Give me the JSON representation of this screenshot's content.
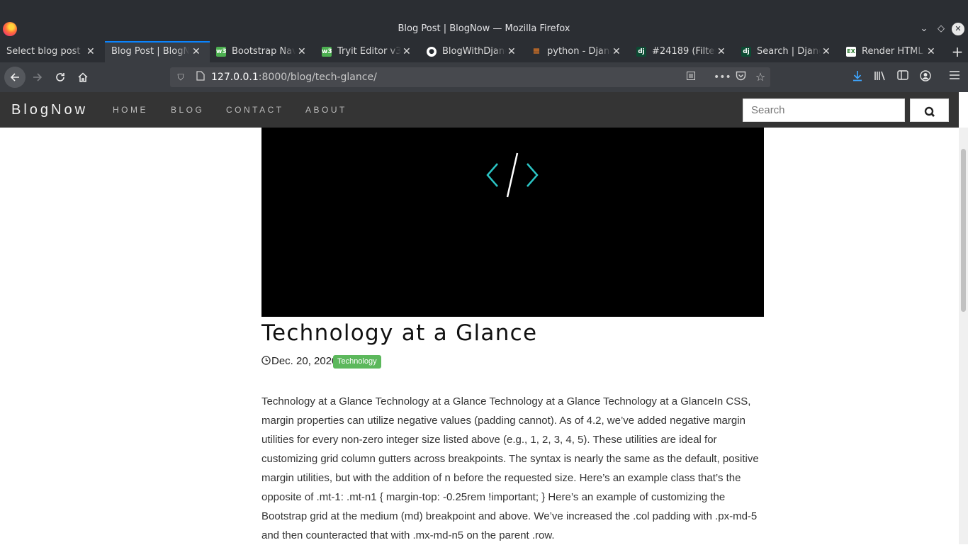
{
  "browser": {
    "window_title": "Blog Post | BlogNow — Mozilla Firefox",
    "tabs": [
      {
        "label": "Select blog post t",
        "active": false
      },
      {
        "label": "Blog Post | BlogN",
        "active": true
      },
      {
        "label": "Bootstrap Nav",
        "active": false
      },
      {
        "label": "Tryit Editor v3.",
        "active": false
      },
      {
        "label": "BlogWithDjang",
        "active": false
      },
      {
        "label": "python - Djang",
        "active": false
      },
      {
        "label": "#24189 (Filter",
        "active": false
      },
      {
        "label": "Search | Djang",
        "active": false
      },
      {
        "label": "Render HTML",
        "active": false
      }
    ],
    "url": {
      "host": "127.0.0.1",
      "rest": ":8000/blog/tech-glance/"
    },
    "icons": {
      "back": "arrow-left-icon",
      "forward": "arrow-right-icon",
      "reload": "reload-icon",
      "home": "home-icon",
      "shield": "shield-icon",
      "page": "page-icon",
      "reader": "reader-view-icon",
      "more": "more-icon",
      "pocket": "pocket-icon",
      "bookmark": "star-icon",
      "downloads": "download-icon",
      "library": "library-icon",
      "sidebar": "sidebar-icon",
      "account": "account-icon",
      "menu": "hamburger-menu-icon"
    }
  },
  "site": {
    "brand": "BlogNow",
    "nav": [
      "HOME",
      "BLOG",
      "CONTACT",
      "ABOUT"
    ],
    "search_placeholder": "Search"
  },
  "post": {
    "title": "Technology at a Glance",
    "date": "Dec. 20, 2020",
    "category": "Technology",
    "body": "Technology at a Glance Technology at a Glance Technology at a Glance Technology at a GlanceIn CSS, margin properties can utilize negative values (padding cannot). As of 4.2, we’ve added negative margin utilities for every non-zero integer size listed above (e.g., 1, 2, 3, 4, 5). These utilities are ideal for customizing grid column gutters across breakpoints. The syntax is nearly the same as the default, positive margin utilities, but with the addition of n before the requested size. Here’s an example class that’s the opposite of .mt-1: .mt-n1 { margin-top: -0.25rem !important; } Here’s an example of customizing the Bootstrap grid at the medium (md) breakpoint and above. We’ve increased the .col padding with .px-md-5 and then counteracted that with .mx-md-n5 on the parent .row."
  },
  "colors": {
    "navbar": "#343434",
    "accent_teal": "#2bc4c4",
    "badge": "#5cb85c",
    "firefox_accent": "#0a84ff"
  }
}
